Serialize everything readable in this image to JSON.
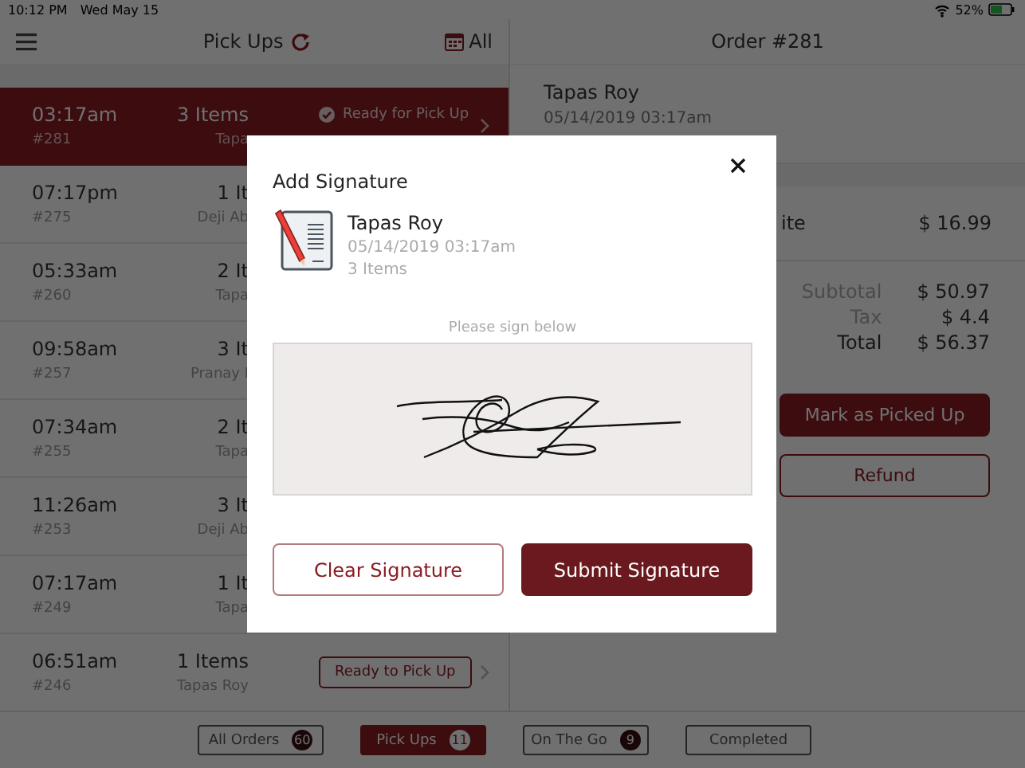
{
  "status_bar": {
    "time": "10:12 PM",
    "date": "Wed May 15",
    "battery": "52%"
  },
  "order_list": {
    "title": "Pick Ups",
    "filter": "All",
    "rows": [
      {
        "time": "03:17am",
        "order": "#281",
        "items": "3 Items",
        "customer": "Tapa",
        "selected": true,
        "status": {
          "kind": "ready",
          "label": "Ready for Pick Up"
        }
      },
      {
        "time": "07:17pm",
        "order": "#275",
        "items": "1 It",
        "customer": "Deji Ab",
        "selected": false
      },
      {
        "time": "05:33am",
        "order": "#260",
        "items": "2 It",
        "customer": "Tapa",
        "selected": false
      },
      {
        "time": "09:58am",
        "order": "#257",
        "items": "3 It",
        "customer": "Pranay I",
        "selected": false
      },
      {
        "time": "07:34am",
        "order": "#255",
        "items": "2 It",
        "customer": "Tapa",
        "selected": false
      },
      {
        "time": "11:26am",
        "order": "#253",
        "items": "3 It",
        "customer": "Deji Ab",
        "selected": false
      },
      {
        "time": "07:17am",
        "order": "#249",
        "items": "1 It",
        "customer": "Tapa",
        "selected": false
      },
      {
        "time": "06:51am",
        "order": "#246",
        "items": "1 Items",
        "customer": "Tapas Roy",
        "selected": false,
        "status": {
          "kind": "button",
          "label": "Ready to Pick Up"
        }
      }
    ]
  },
  "order_detail": {
    "title": "Order #281",
    "customer": "Tapas Roy",
    "date": "05/14/2019 03:17am",
    "line_items": [
      {
        "name": "ite",
        "price": "$ 16.99"
      }
    ],
    "totals": [
      {
        "label": "Subtotal",
        "value": "$ 50.97",
        "kind": "sub"
      },
      {
        "label": "Tax",
        "value": "$ 4.4",
        "kind": "sub"
      },
      {
        "label": "Total",
        "value": "$ 56.37",
        "kind": "total"
      }
    ],
    "actions": [
      {
        "label": "Mark as Picked Up",
        "kind": "primary"
      },
      {
        "label": "Refund",
        "kind": "outline"
      }
    ]
  },
  "tabs": [
    {
      "label": "All Orders",
      "count": "60",
      "selected": false
    },
    {
      "label": "Pick Ups",
      "count": "11",
      "selected": true
    },
    {
      "label": "On The Go",
      "count": "9",
      "selected": false
    },
    {
      "label": "Completed",
      "selected": false
    }
  ],
  "modal": {
    "title": "Add Signature",
    "customer": "Tapas Roy",
    "date": "05/14/2019 03:17am",
    "items": "3 Items",
    "prompt": "Please sign below",
    "buttons": [
      {
        "label": "Clear Signature",
        "kind": "outline"
      },
      {
        "label": "Submit Signature",
        "kind": "primary"
      }
    ]
  }
}
